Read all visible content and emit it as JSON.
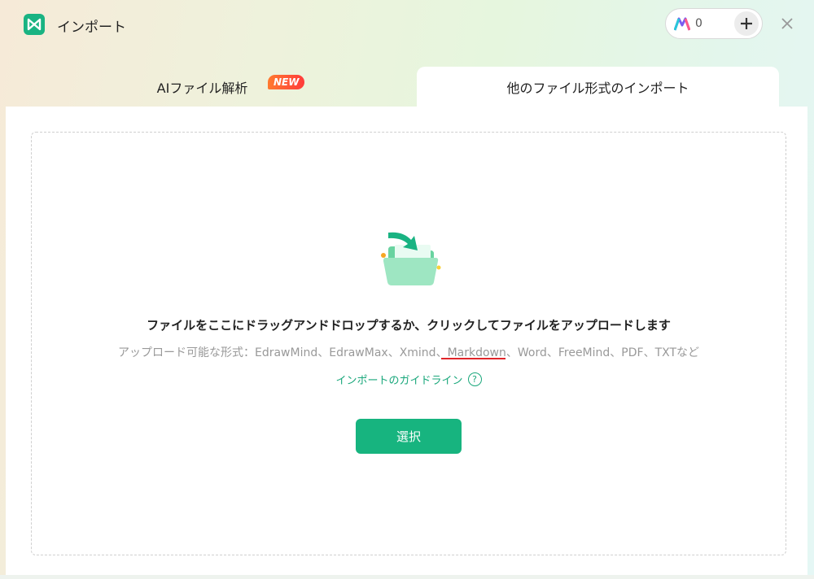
{
  "window": {
    "title": "インポート"
  },
  "credits": {
    "count": "0",
    "plus_icon": "plus-icon",
    "brand_icon": "credits-logo-icon"
  },
  "tabs": {
    "ai": {
      "label": "AIファイル解析",
      "badge": "NEW"
    },
    "import": {
      "label": "他のファイル形式のインポート"
    }
  },
  "dropzone": {
    "main_text": "ファイルをここにドラッグアンドドロップするか、クリックしてファイルをアップロードします",
    "formats_prefix": "アップロード可能な形式：",
    "formats_list": "EdrawMind、EdrawMax、Xmind、Markdown、Word、FreeMind、PDF、TXTなど",
    "guide_link": "インポートのガイドライン",
    "select_button": "選択"
  },
  "colors": {
    "accent": "#17b47f",
    "badge": "#ff4b36",
    "underline": "#e0262a"
  }
}
